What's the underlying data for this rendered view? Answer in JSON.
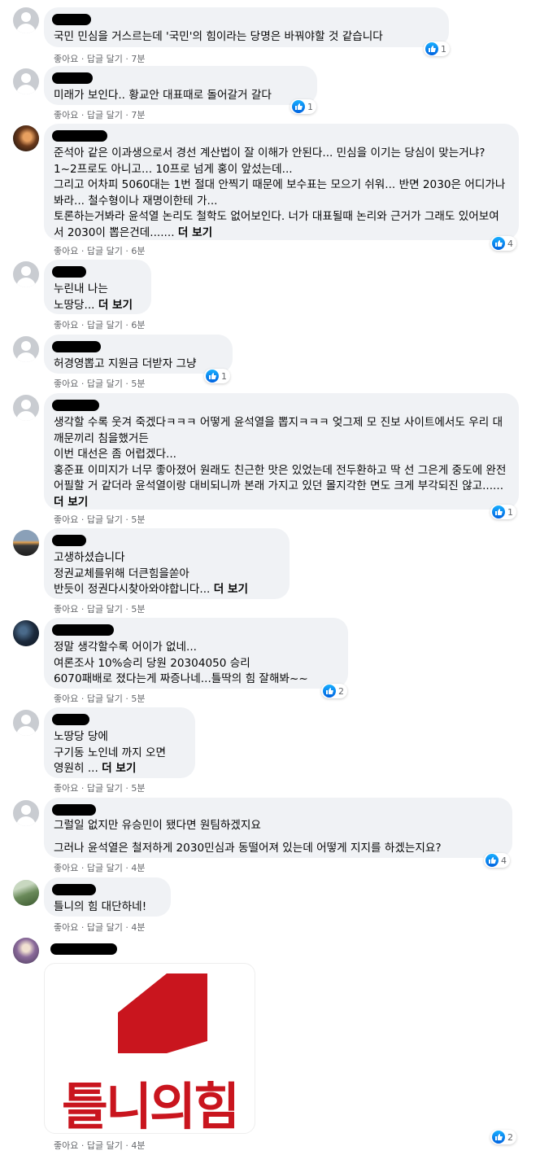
{
  "like_label": "좋아요",
  "reply_label": "답글 달기",
  "separator": "·",
  "more_label": "더 보기",
  "colors": {
    "bubble": "#f0f2f5",
    "meta": "#65676b",
    "like_blue": "#0571ed",
    "logo_red": "#c9151e"
  },
  "comments": [
    {
      "text": "국민 민심을 거스르는데 '국민'의 힘이라는 당명은 바꿔야할 것 같습니다",
      "time": "7분",
      "reactions": "1"
    },
    {
      "text": "미래가 보인다.. 황교안 대표때로 돌어갈거 갈다",
      "time": "7분",
      "reactions": "1"
    },
    {
      "text": "준석아 같은 이과생으로서 경선 계산법이 잘 이해가 안된다... 민심을 이기는 당심이 맞는거냐? 1~2프로도 아니고... 10프로 넘게 홍이 앞섰는데...\n그리고 어차피 5060대는 1번 절대 안찍기 때문에 보수표는 모으기 쉬워... 반면 2030은 어디가나봐라... 철수형이나 재명이한테 가...\n토론하는거봐라 윤석열 논리도 철학도 없어보인다. 너가 대표될때 논리와 근거가 그래도 있어보여서 2030이 뽑은건데.......",
      "time": "6분",
      "reactions": "4"
    },
    {
      "text": "누린내 나는\n노땅당...",
      "time": "6분",
      "reactions": ""
    },
    {
      "text": "허경영뽑고 지원금 더받자 그냥",
      "time": "5분",
      "reactions": "1"
    },
    {
      "text": "생각할 수록 웃겨 죽겠다ㅋㅋㅋ 어떻게 윤석열을 뽑지ㅋㅋㅋ 엊그제 모 진보 사이트에서도 우리 대깨문끼리 침을했거든\n이번 대선은 좀 어렵겠다...\n홍준표 이미지가 너무 좋아졌어 원래도 친근한 맛은 있었는데 전두환하고 딱 선 그은게 중도에 완전 어필할 거 같더라 윤석열이랑 대비되니까 본래 가지고 있던 몰지각한 면도 크게 부각되진 않고......",
      "time": "5분",
      "reactions": "1"
    },
    {
      "text": "고생하셨습니다\n정권교체를위해 더큰힘을쏟아\n반듯이 정권다시찾아와야합니다...",
      "time": "5분",
      "reactions": ""
    },
    {
      "text": "정말 생각할수록 어이가 없네...\n여론조사 10%승리 당원 20304050 승리\n6070패배로 졌다는게 짜증나네...틀딱의 힘 잘해봐~~",
      "time": "5분",
      "reactions": "2"
    },
    {
      "text": "노땅당 당에\n구기동 노인네 까지 오면\n영원히 ...",
      "time": "5분",
      "reactions": ""
    },
    {
      "text": "그럴일 없지만 유승민이 됐다면 원팀하겠지요\n\n그러나 윤석열은 철저하게 2030민심과 동떨어져 있는데 어떻게 지지를 하겠는지요?",
      "time": "4분",
      "reactions": "4"
    },
    {
      "text": "틀니의 힘 대단하네!",
      "time": "4분",
      "reactions": ""
    },
    {
      "text": "",
      "time": "4분",
      "reactions": "2",
      "image_text": "틀니의힘"
    }
  ]
}
